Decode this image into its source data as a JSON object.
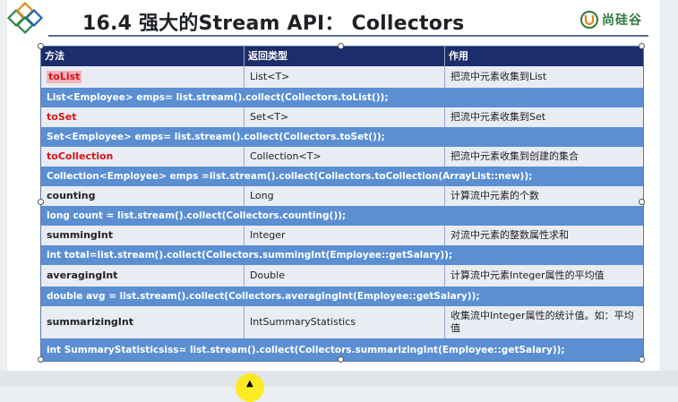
{
  "slide": {
    "title": "16.4 强大的Stream API： Collectors",
    "brand": "尚硅谷"
  },
  "table": {
    "headers": [
      "方法",
      "返回类型",
      "作用"
    ],
    "rows": [
      {
        "method": "toList",
        "return_type": "List<T>",
        "purpose": "把流中元素收集到List",
        "code": "List<Employee> emps= list.stream().collect(Collectors.toList());"
      },
      {
        "method": "toSet",
        "return_type": "Set<T>",
        "purpose": "把流中元素收集到Set",
        "code": "Set<Employee> emps= list.stream().collect(Collectors.toSet());"
      },
      {
        "method": "toCollection",
        "return_type": "Collection<T>",
        "purpose": "把流中元素收集到创建的集合",
        "code": "Collection<Employee> emps =list.stream().collect(Collectors.toCollection(ArrayList::new));"
      },
      {
        "method": "counting",
        "return_type": "Long",
        "purpose": "计算流中元素的个数",
        "code": "long count = list.stream().collect(Collectors.counting());"
      },
      {
        "method": "summingInt",
        "return_type": "Integer",
        "purpose": "对流中元素的整数属性求和",
        "code": "int total=list.stream().collect(Collectors.summingInt(Employee::getSalary));"
      },
      {
        "method": "averagingInt",
        "return_type": "Double",
        "purpose": "计算流中元素Integer属性的平均值",
        "code": "double avg = list.stream().collect(Collectors.averagingInt(Employee::getSalary));"
      },
      {
        "method": "summarizingInt",
        "return_type": "IntSummaryStatistics",
        "purpose": "收集流中Integer属性的统计值。如：平均值",
        "code": "int SummaryStatisticsiss= list.stream().collect(Collectors.summarizingInt(Employee::getSalary));"
      }
    ]
  },
  "colors": {
    "header_bg": "#1b2d6b",
    "code_row_bg": "#5b8fd2",
    "method_red": "#d4161a",
    "brand_green": "#2c7a3c"
  },
  "icons": {
    "logo": "diamond-logo-icon",
    "brand": "brand-u-icon",
    "cursor": "mouse-cursor-highlight"
  }
}
